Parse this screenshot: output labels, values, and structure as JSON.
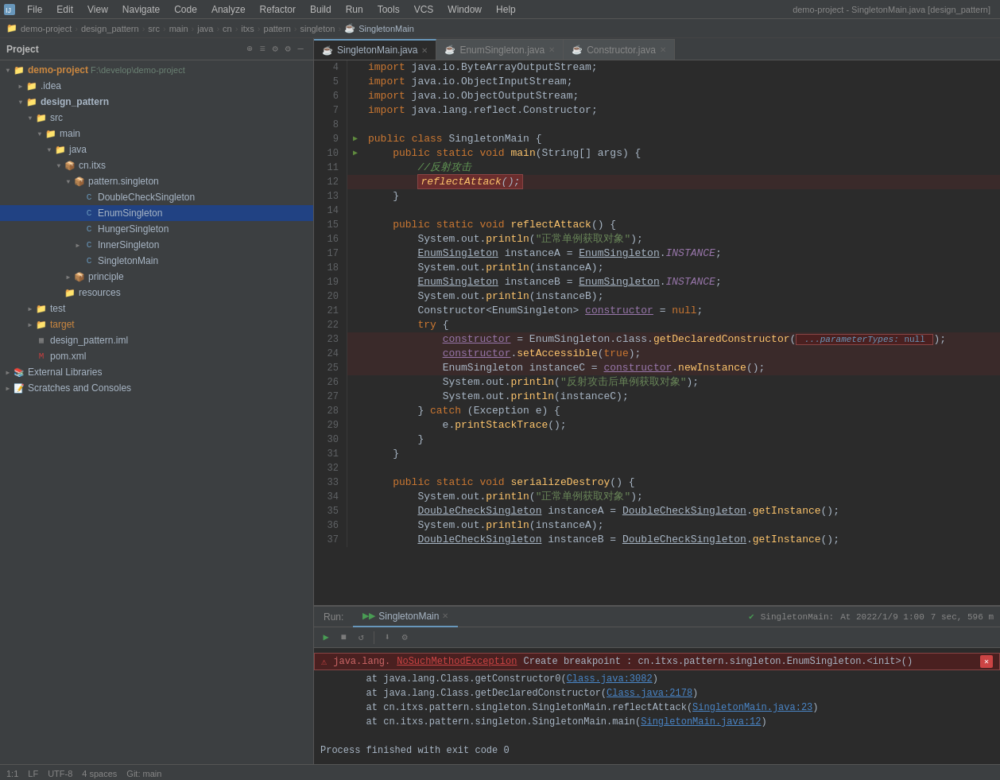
{
  "window": {
    "title": "demo-project - SingletonMain.java [design_pattern]"
  },
  "menu": {
    "items": [
      "File",
      "Edit",
      "View",
      "Navigate",
      "Code",
      "Analyze",
      "Refactor",
      "Build",
      "Run",
      "Tools",
      "VCS",
      "Window",
      "Help"
    ]
  },
  "breadcrumb": {
    "items": [
      "demo-project",
      "design_pattern",
      "src",
      "main",
      "java",
      "cn",
      "itxs",
      "pattern",
      "singleton",
      "SingletonMain"
    ]
  },
  "sidebar": {
    "title": "Project",
    "tree": [
      {
        "id": "demo-project",
        "label": "demo-project",
        "path": "F:\\develop\\demo-project",
        "indent": 0,
        "type": "module",
        "expanded": true,
        "arrow": "▼"
      },
      {
        "id": "idea",
        "label": ".idea",
        "indent": 1,
        "type": "folder",
        "expanded": false,
        "arrow": "▶"
      },
      {
        "id": "design_pattern",
        "label": "design_pattern",
        "indent": 1,
        "type": "folder-module",
        "expanded": true,
        "arrow": "▼"
      },
      {
        "id": "src",
        "label": "src",
        "indent": 2,
        "type": "folder",
        "expanded": true,
        "arrow": "▼"
      },
      {
        "id": "main",
        "label": "main",
        "indent": 3,
        "type": "folder",
        "expanded": true,
        "arrow": "▼"
      },
      {
        "id": "java",
        "label": "java",
        "indent": 4,
        "type": "folder-src",
        "expanded": true,
        "arrow": "▼"
      },
      {
        "id": "cn.itxs",
        "label": "cn.itxs",
        "indent": 5,
        "type": "package",
        "expanded": true,
        "arrow": "▼"
      },
      {
        "id": "pattern.singleton",
        "label": "pattern.singleton",
        "indent": 6,
        "type": "package",
        "expanded": true,
        "arrow": "▼"
      },
      {
        "id": "DoubleCheckSingleton",
        "label": "DoubleCheckSingleton",
        "indent": 7,
        "type": "java-class",
        "arrow": ""
      },
      {
        "id": "EnumSingleton",
        "label": "EnumSingleton",
        "indent": 7,
        "type": "java-class",
        "arrow": "",
        "selected": true
      },
      {
        "id": "HungerSingleton",
        "label": "HungerSingleton",
        "indent": 7,
        "type": "java-class",
        "arrow": ""
      },
      {
        "id": "InnerSingleton",
        "label": "InnerSingleton",
        "indent": 7,
        "type": "java-class",
        "arrow": "▶"
      },
      {
        "id": "SingletonMain",
        "label": "SingletonMain",
        "indent": 7,
        "type": "java-class",
        "arrow": ""
      },
      {
        "id": "principle",
        "label": "principle",
        "indent": 6,
        "type": "package",
        "expanded": false,
        "arrow": "▶"
      },
      {
        "id": "resources",
        "label": "resources",
        "indent": 5,
        "type": "folder",
        "arrow": ""
      },
      {
        "id": "test",
        "label": "test",
        "indent": 2,
        "type": "folder",
        "expanded": false,
        "arrow": "▶"
      },
      {
        "id": "target",
        "label": "target",
        "indent": 2,
        "type": "folder-target",
        "expanded": false,
        "arrow": "▶"
      },
      {
        "id": "design_pattern.iml",
        "label": "design_pattern.iml",
        "indent": 2,
        "type": "iml",
        "arrow": ""
      },
      {
        "id": "pom.xml",
        "label": "pom.xml",
        "indent": 2,
        "type": "pom",
        "arrow": ""
      },
      {
        "id": "External Libraries",
        "label": "External Libraries",
        "indent": 0,
        "type": "libs",
        "expanded": false,
        "arrow": "▶"
      },
      {
        "id": "Scratches and Consoles",
        "label": "Scratches and Consoles",
        "indent": 0,
        "type": "scratches",
        "expanded": false,
        "arrow": "▶"
      }
    ]
  },
  "editor": {
    "tabs": [
      {
        "id": "SingletonMain",
        "label": "SingletonMain.java",
        "active": true,
        "modified": false
      },
      {
        "id": "EnumSingleton",
        "label": "EnumSingleton.java",
        "active": false,
        "modified": false
      },
      {
        "id": "Constructor",
        "label": "Constructor.java",
        "active": false,
        "modified": false
      }
    ],
    "lines": [
      {
        "num": 4,
        "content": "import java.io.ByteArrayOutputStream;"
      },
      {
        "num": 5,
        "content": "import java.io.ObjectInputStream;"
      },
      {
        "num": 6,
        "content": "import java.io.ObjectOutputStream;"
      },
      {
        "num": 7,
        "content": "import java.lang.reflect.Constructor;"
      },
      {
        "num": 8,
        "content": ""
      },
      {
        "num": 9,
        "content": "public class SingletonMain {",
        "arrow": true
      },
      {
        "num": 10,
        "content": "    public static void main(String[] args) {",
        "arrow": true
      },
      {
        "num": 11,
        "content": "        //反射攻击"
      },
      {
        "num": 12,
        "content": "        reflectAttack();",
        "highlight": true
      },
      {
        "num": 13,
        "content": "    }"
      },
      {
        "num": 14,
        "content": ""
      },
      {
        "num": 15,
        "content": "    public static void reflectAttack() {"
      },
      {
        "num": 16,
        "content": "        System.out.println(\"正常单例获取对象\");"
      },
      {
        "num": 17,
        "content": "        EnumSingleton instanceA = EnumSingleton.INSTANCE;"
      },
      {
        "num": 18,
        "content": "        System.out.println(instanceA);"
      },
      {
        "num": 19,
        "content": "        EnumSingleton instanceB = EnumSingleton.INSTANCE;"
      },
      {
        "num": 20,
        "content": "        System.out.println(instanceB);"
      },
      {
        "num": 21,
        "content": "        Constructor<EnumSingleton> constructor = null;"
      },
      {
        "num": 22,
        "content": "        try {"
      },
      {
        "num": 23,
        "content": "            constructor = EnumSingleton.class.getDeclaredConstructor( ...parameterTypes: null );",
        "error_box": true
      },
      {
        "num": 24,
        "content": "            constructor.setAccessible(true);"
      },
      {
        "num": 25,
        "content": "            EnumSingleton instanceC = constructor.newInstance();"
      },
      {
        "num": 26,
        "content": "            System.out.println(\"反射攻击后单例获取对象\");"
      },
      {
        "num": 27,
        "content": "            System.out.println(instanceC);"
      },
      {
        "num": 28,
        "content": "        } catch (Exception e) {"
      },
      {
        "num": 29,
        "content": "            e.printStackTrace();"
      },
      {
        "num": 30,
        "content": "        }"
      },
      {
        "num": 31,
        "content": "    }"
      },
      {
        "num": 32,
        "content": ""
      },
      {
        "num": 33,
        "content": "    public static void serializeDestroy() {"
      },
      {
        "num": 34,
        "content": "        System.out.println(\"正常单例获取对象\");"
      },
      {
        "num": 35,
        "content": "        DoubleCheckSingleton instanceA = DoubleCheckSingleton.getInstance();"
      },
      {
        "num": 36,
        "content": "        System.out.println(instanceA);"
      },
      {
        "num": 37,
        "content": "        DoubleCheckSingleton instanceB = DoubleCheckSingleton.getInstance();"
      }
    ]
  },
  "bottom_panel": {
    "tabs": [
      {
        "id": "run",
        "label": "Run",
        "active": true
      },
      {
        "id": "SingletonMain",
        "label": "SingletonMain",
        "active": false
      }
    ],
    "run_header": {
      "label": "SingletonMain",
      "status": "At 2022/1/9 1:00",
      "time": "7 sec, 596 m"
    },
    "output": [
      {
        "type": "error",
        "text": "java.lang.NoSuchMethodException Create breakpoint : cn.itxs.pattern.singleton.EnumSingleton.<init>()",
        "has_link": true
      },
      {
        "type": "normal",
        "text": "\tat java.lang.Class.getConstructor0(",
        "link": "Class.java:3082",
        "suffix": ")"
      },
      {
        "type": "normal",
        "text": "\tat java.lang.Class.getDeclaredConstructor(",
        "link": "Class.java:2178",
        "suffix": ")"
      },
      {
        "type": "normal",
        "text": "\tat cn.itxs.pattern.singleton.SingletonMain.reflectAttack(",
        "link": "SingletonMain.java:23",
        "suffix": ")"
      },
      {
        "type": "normal",
        "text": "\tat cn.itxs.pattern.singleton.SingletonMain.main(",
        "link": "SingletonMain.java:12",
        "suffix": ")"
      },
      {
        "type": "normal",
        "text": ""
      },
      {
        "type": "normal",
        "text": "Process finished with exit code 0"
      }
    ]
  },
  "status_bar": {
    "items": [
      "1:1",
      "LF",
      "UTF-8",
      "4 spaces",
      "Git: main"
    ]
  }
}
